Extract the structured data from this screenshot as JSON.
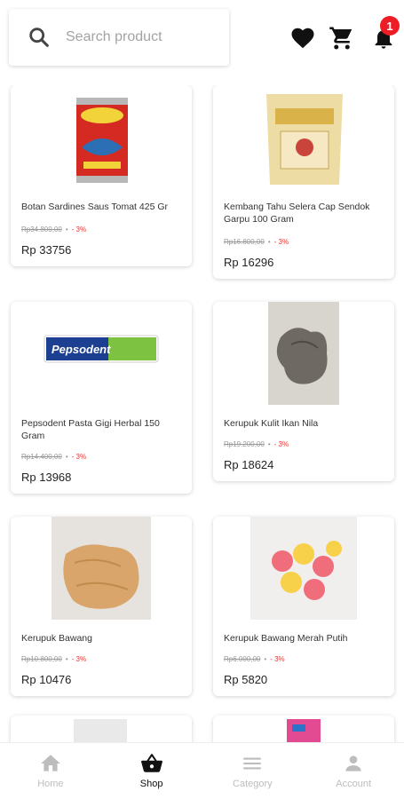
{
  "search": {
    "placeholder": "Search product"
  },
  "header": {
    "cart_badge": "1"
  },
  "products": [
    {
      "name": "Botan Sardines Saus Tomat 425 Gr",
      "old_price": "Rp34.800,00",
      "discount": "3%",
      "price": "Rp 33756"
    },
    {
      "name": "Kembang Tahu Selera Cap Sendok Garpu 100 Gram",
      "old_price": "Rp16.800,00",
      "discount": "3%",
      "price": "Rp 16296"
    },
    {
      "name": "Pepsodent Pasta Gigi Herbal 150 Gram",
      "old_price": "Rp14.400,00",
      "discount": "3%",
      "price": "Rp 13968"
    },
    {
      "name": "Kerupuk Kulit Ikan Nila",
      "old_price": "Rp19.200,00",
      "discount": "3%",
      "price": "Rp 18624"
    },
    {
      "name": "Kerupuk Bawang",
      "old_price": "Rp10.800,00",
      "discount": "3%",
      "price": "Rp 10476"
    },
    {
      "name": "Kerupuk Bawang Merah Putih",
      "old_price": "Rp6.000,00",
      "discount": "3%",
      "price": "Rp 5820"
    }
  ],
  "nav": [
    {
      "label": "Home",
      "icon": "home-icon"
    },
    {
      "label": "Shop",
      "icon": "basket-icon"
    },
    {
      "label": "Category",
      "icon": "menu-icon"
    },
    {
      "label": "Account",
      "icon": "account-icon"
    }
  ],
  "colors": {
    "accent": "#111111",
    "discount": "#e53935",
    "badge": "#ee1c25",
    "inactive": "#bdbdbd"
  }
}
